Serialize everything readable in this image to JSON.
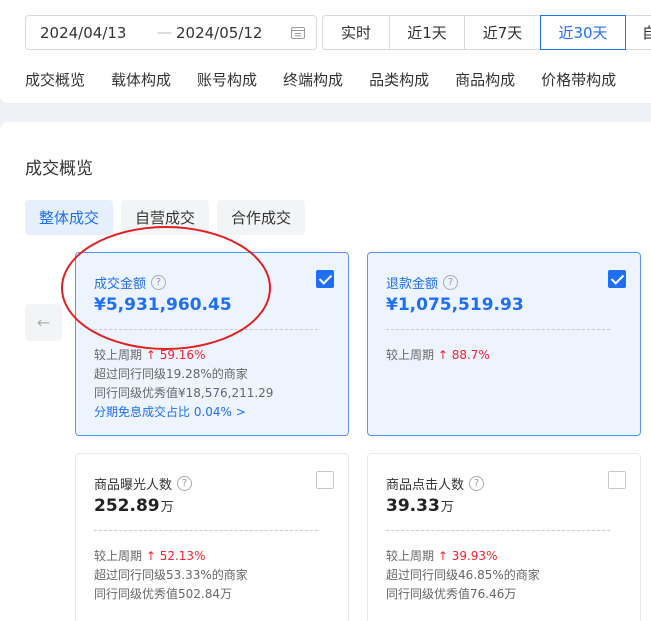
{
  "date_range": {
    "start": "2024/04/13",
    "separator": "—",
    "end": "2024/05/12"
  },
  "range_buttons": [
    {
      "label": "实时",
      "active": false
    },
    {
      "label": "近1天",
      "active": false
    },
    {
      "label": "近7天",
      "active": false
    },
    {
      "label": "近30天",
      "active": true
    },
    {
      "label": "自",
      "active": false
    }
  ],
  "sub_tabs": [
    "成交概览",
    "载体构成",
    "账号构成",
    "终端构成",
    "品类构成",
    "商品构成",
    "价格带构成"
  ],
  "section_title": "成交概览",
  "scope_tabs": [
    {
      "label": "整体成交",
      "active": true
    },
    {
      "label": "自营成交",
      "active": false
    },
    {
      "label": "合作成交",
      "active": false
    }
  ],
  "prev_arrow": "←",
  "cards": {
    "gmv": {
      "label": "成交金额",
      "value": "¥5,931,960.45",
      "checked": true,
      "compare_label": "较上周期",
      "compare_value": "↑ 59.16%",
      "line2": "超过同行同级19.28%的商家",
      "line3": "同行同级优秀值¥18,576,211.29",
      "link": "分期免息成交占比 0.04% >"
    },
    "refund": {
      "label": "退款金额",
      "value": "¥1,075,519.93",
      "checked": true,
      "compare_label": "较上周期",
      "compare_value": "↑ 88.7%"
    },
    "exposure": {
      "label": "商品曝光人数",
      "value": "252.89",
      "unit": "万",
      "checked": false,
      "compare_label": "较上周期",
      "compare_value": "↑ 52.13%",
      "line2": "超过同行同级53.33%的商家",
      "line3": "同行同级优秀值502.84万"
    },
    "clicks": {
      "label": "商品点击人数",
      "value": "39.33",
      "unit": "万",
      "checked": false,
      "compare_label": "较上周期",
      "compare_value": "↑ 39.93%",
      "line2": "超过同行同级46.85%的商家",
      "line3": "同行同级优秀值76.46万"
    }
  },
  "colors": {
    "accent": "#1e6ff1",
    "up": "#f5222d",
    "annotation": "#e02020"
  }
}
